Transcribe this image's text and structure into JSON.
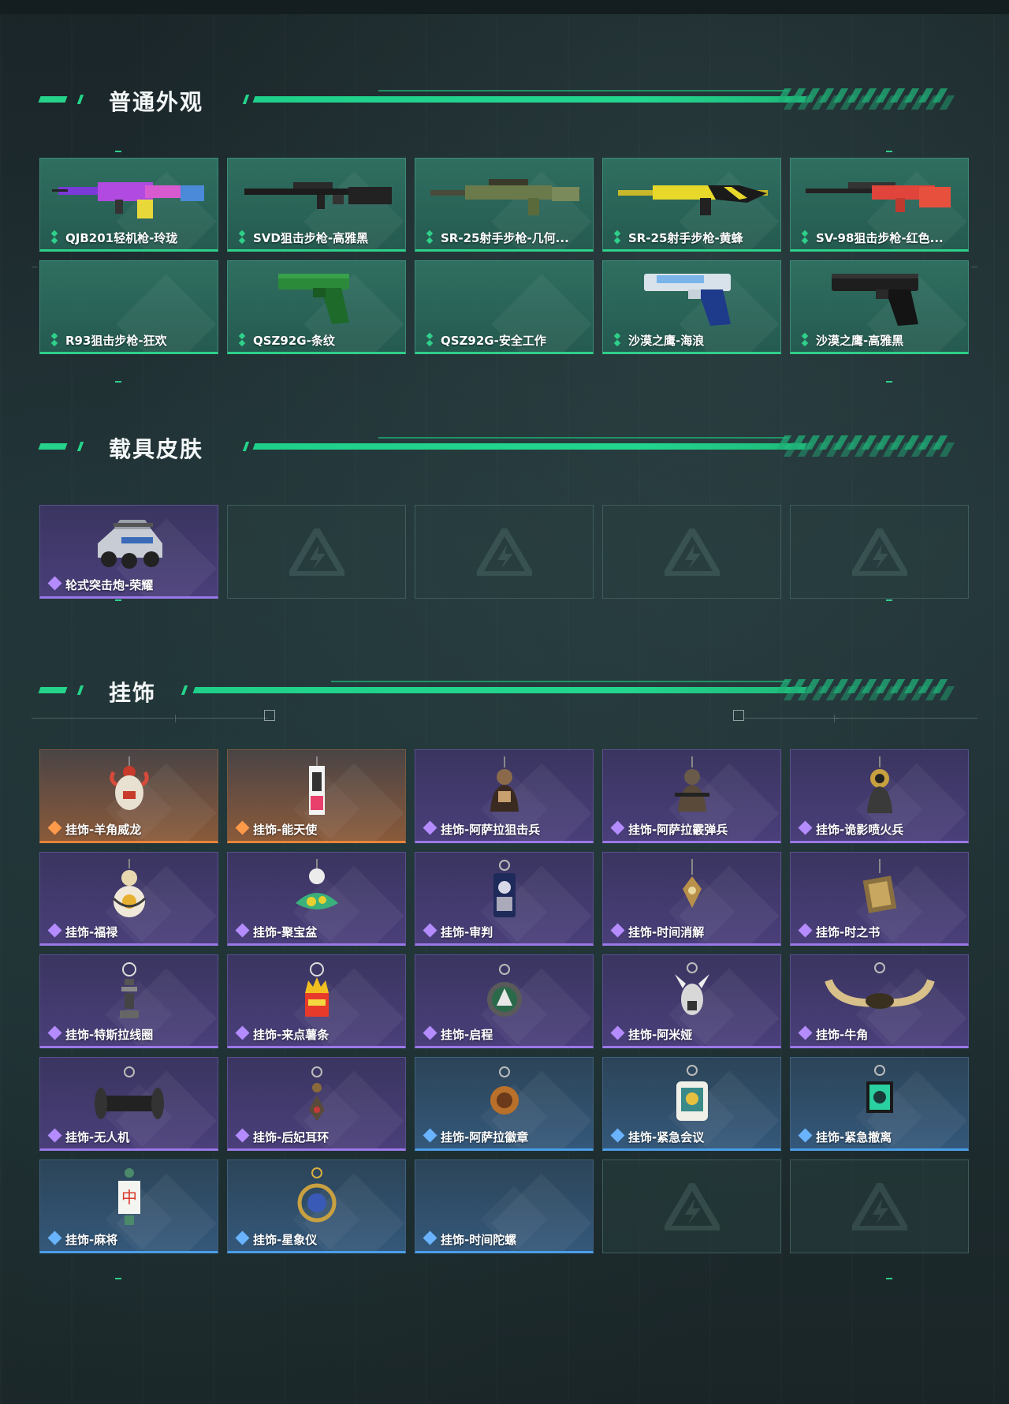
{
  "sections": {
    "weapons": {
      "title": "普通外观"
    },
    "vehicles": {
      "title": "载具皮肤"
    },
    "charms": {
      "title": "挂饰"
    }
  },
  "weapons": [
    {
      "label": "QJB201轻机枪-玲珑",
      "icon": "lmg-icon"
    },
    {
      "label": "SVD狙击步枪-高雅黑",
      "icon": "sniper-rifle-icon"
    },
    {
      "label": "SR-25射手步枪-几何...",
      "icon": "marksman-rifle-icon"
    },
    {
      "label": "SR-25射手步枪-黄蜂",
      "icon": "marksman-rifle-icon"
    },
    {
      "label": "SV-98狙击步枪-红色...",
      "icon": "sniper-rifle-icon"
    },
    {
      "label": "R93狙击步枪-狂欢",
      "icon": ""
    },
    {
      "label": "QSZ92G-条纹",
      "icon": "pistol-icon"
    },
    {
      "label": "QSZ92G-安全工作",
      "icon": ""
    },
    {
      "label": "沙漠之鹰-海浪",
      "icon": "pistol-icon"
    },
    {
      "label": "沙漠之鹰-高雅黑",
      "icon": "pistol-icon"
    }
  ],
  "vehicles": [
    {
      "label": "轮式突击炮-荣耀",
      "icon": "armored-vehicle-icon"
    }
  ],
  "charms": [
    {
      "label": "挂饰-羊角威龙",
      "rarity": "orange"
    },
    {
      "label": "挂饰-能天使",
      "rarity": "orange"
    },
    {
      "label": "挂饰-阿萨拉狙击兵",
      "rarity": "purple"
    },
    {
      "label": "挂饰-阿萨拉霰弹兵",
      "rarity": "purple"
    },
    {
      "label": "挂饰-诡影喷火兵",
      "rarity": "purple"
    },
    {
      "label": "挂饰-福禄",
      "rarity": "purple"
    },
    {
      "label": "挂饰-聚宝盆",
      "rarity": "purple"
    },
    {
      "label": "挂饰-审判",
      "rarity": "purple"
    },
    {
      "label": "挂饰-时间消解",
      "rarity": "purple"
    },
    {
      "label": "挂饰-时之书",
      "rarity": "purple"
    },
    {
      "label": "挂饰-特斯拉线圈",
      "rarity": "purple"
    },
    {
      "label": "挂饰-来点薯条",
      "rarity": "purple"
    },
    {
      "label": "挂饰-启程",
      "rarity": "purple"
    },
    {
      "label": "挂饰-阿米娅",
      "rarity": "purple"
    },
    {
      "label": "挂饰-牛角",
      "rarity": "purple"
    },
    {
      "label": "挂饰-无人机",
      "rarity": "purple"
    },
    {
      "label": "挂饰-后妃耳环",
      "rarity": "purple"
    },
    {
      "label": "挂饰-阿萨拉徽章",
      "rarity": "blue"
    },
    {
      "label": "挂饰-紧急会议",
      "rarity": "blue"
    },
    {
      "label": "挂饰-紧急撤离",
      "rarity": "blue"
    },
    {
      "label": "挂饰-麻将",
      "rarity": "blue"
    },
    {
      "label": "挂饰-星象仪",
      "rarity": "blue"
    },
    {
      "label": "挂饰-时间陀螺",
      "rarity": "blue"
    }
  ],
  "colors": {
    "accent": "#25d38a",
    "green_rarity": "#2fd08a",
    "purple_rarity": "#9b78e8",
    "orange_rarity": "#e8843a",
    "blue_rarity": "#4a9ee8"
  }
}
